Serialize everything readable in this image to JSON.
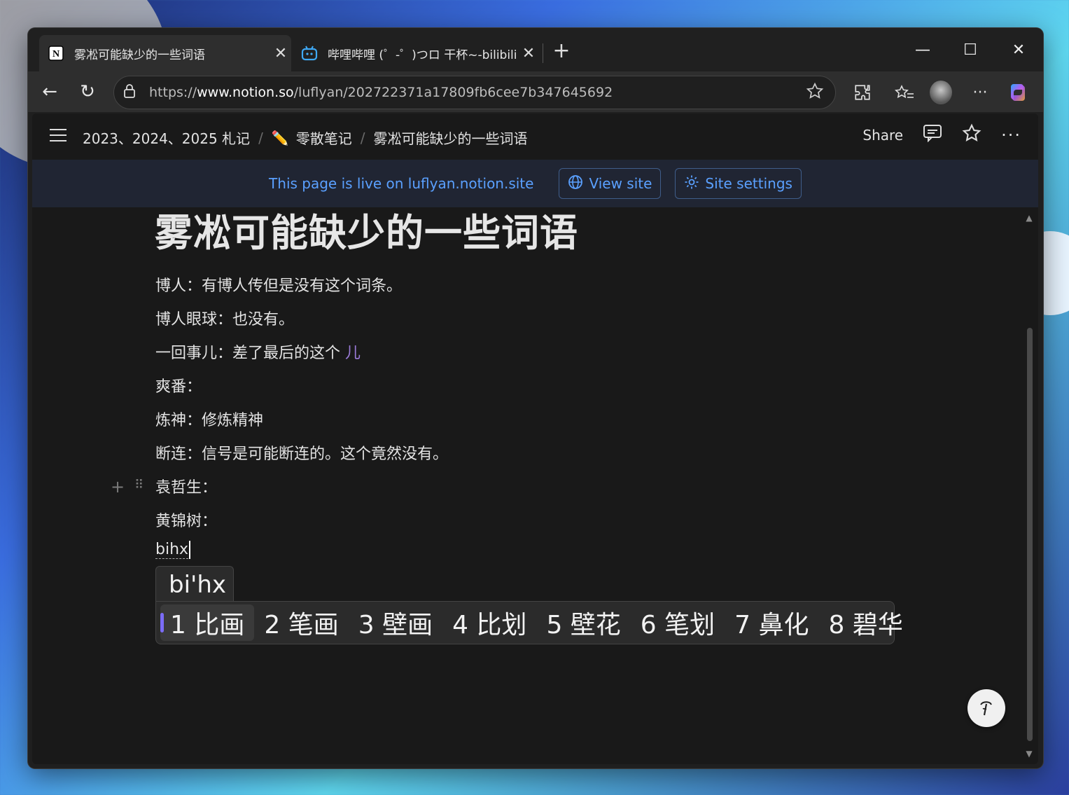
{
  "browser": {
    "tabs": [
      {
        "title": "雾凇可能缺少的一些词语",
        "favicon": "notion-icon",
        "active": true
      },
      {
        "title": "哔哩哔哩 (゜-゜)つロ 干杯~-bilibili",
        "favicon": "bilibili-icon",
        "active": false
      }
    ],
    "url_prefix": "https://",
    "url_host": "www.notion.so",
    "url_path": "/luflyan/202722371a17809fb6cee7b347645692"
  },
  "notion": {
    "breadcrumbs": [
      "2023、2024、2025 札记",
      "零散笔记",
      "雾凇可能缺少的一些词语"
    ],
    "breadcrumb_sep": "/",
    "breadcrumb_icon": "✏️",
    "share_label": "Share",
    "banner_message": "This page is live on luflyan.notion.site",
    "view_site_label": "View site",
    "site_settings_label": "Site settings",
    "page_title": "雾凇可能缺少的一些词语",
    "lines": [
      "博人：有博人传但是没有这个词条。",
      "博人眼球：也没有。",
      "一回事儿：差了最后的这个",
      "爽番：",
      "炼神：修炼精神",
      "断连：信号是可能断连的。这个竟然没有。",
      "袁哲生：",
      "黄锦树："
    ],
    "line3_highlight": "儿",
    "typed_text": "bihx"
  },
  "ime": {
    "composition": "bi'hx",
    "candidates": [
      "1 比画",
      "2 笔画",
      "3 壁画",
      "4 比划",
      "5 壁花",
      "6 笔划",
      "7 鼻化",
      "8 碧华"
    ],
    "selected_index": 0
  },
  "colors": {
    "accent": "#5aa0ff",
    "ime_selection": "#7b6cf6",
    "highlight_text": "#9b7bd9"
  }
}
